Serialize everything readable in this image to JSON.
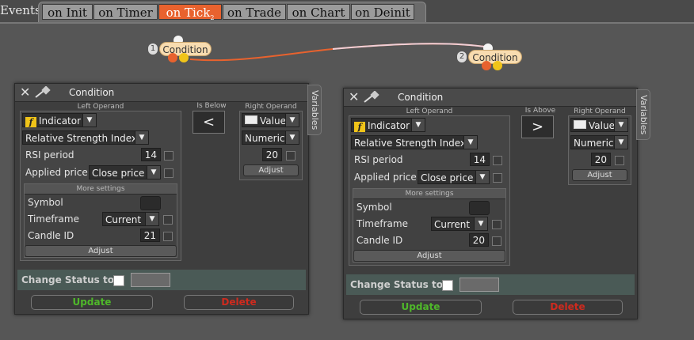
{
  "tabbar": {
    "events_label": "Events",
    "tabs": [
      {
        "label": "on Init"
      },
      {
        "label": "on Timer"
      },
      {
        "label": "on Tick",
        "sub": "2"
      },
      {
        "label": "on Trade"
      },
      {
        "label": "on Chart"
      },
      {
        "label": "on Deinit"
      }
    ]
  },
  "nodes": [
    {
      "num": "1",
      "label": "Condition"
    },
    {
      "num": "2",
      "label": "Condition"
    }
  ],
  "windows": [
    {
      "title": "Condition",
      "variables": "Variables",
      "left_operand_label": "Left Operand",
      "comparator_label": "Is Below",
      "comparator": "<",
      "right_operand_label": "Right Operand",
      "left_type": "Indicator",
      "indicator": "Relative Strength Index",
      "rsi_period_label": "RSI period",
      "rsi_period": "14",
      "applied_price_label": "Applied price",
      "applied_price": "Close price",
      "more_settings": "More settings",
      "symbol_label": "Symbol",
      "timeframe_label": "Timeframe",
      "timeframe": "Current",
      "candle_label": "Candle ID",
      "candle_id": "21",
      "adjust": "Adjust",
      "right_type": "Value",
      "right_format": "Numeric",
      "right_value": "20",
      "right_adjust": "Adjust",
      "change_status": "Change Status to",
      "update": "Update",
      "delete": "Delete"
    },
    {
      "title": "Condition",
      "variables": "Variables",
      "left_operand_label": "Left Operand",
      "comparator_label": "Is Above",
      "comparator": ">",
      "right_operand_label": "Right Operand",
      "left_type": "Indicator",
      "indicator": "Relative Strength Index",
      "rsi_period_label": "RSI period",
      "rsi_period": "14",
      "applied_price_label": "Applied price",
      "applied_price": "Close price",
      "more_settings": "More settings",
      "symbol_label": "Symbol",
      "timeframe_label": "Timeframe",
      "timeframe": "Current",
      "candle_label": "Candle ID",
      "candle_id": "20",
      "adjust": "Adjust",
      "right_type": "Value",
      "right_format": "Numeric",
      "right_value": "20",
      "right_adjust": "Adjust",
      "change_status": "Change Status to",
      "update": "Update",
      "delete": "Delete"
    }
  ],
  "colors": {
    "active_tab": "#e8622e",
    "update": "#4fb82a",
    "delete": "#cf2a1e",
    "node_fill": "#f8dcb0"
  }
}
